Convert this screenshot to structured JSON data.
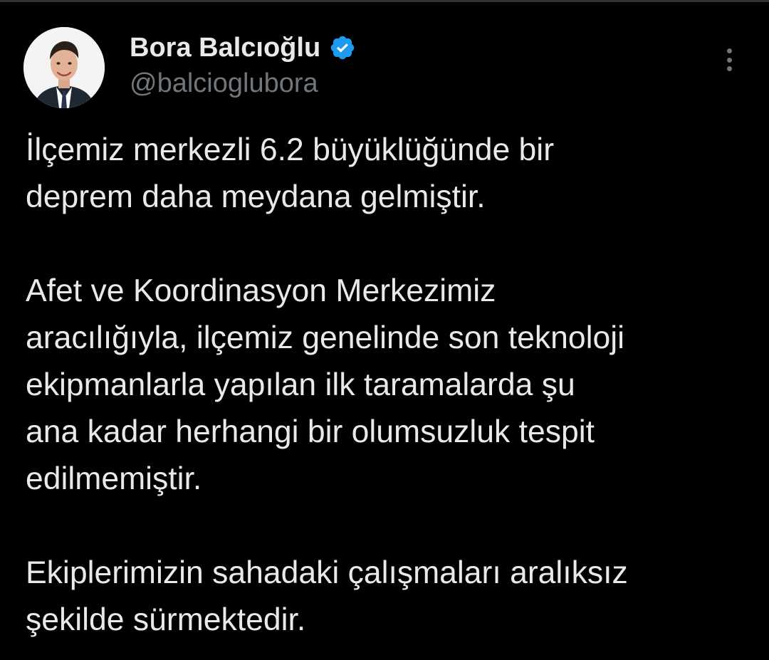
{
  "author": {
    "display_name": "Bora Balcıoğlu",
    "handle": "@balcioglubora",
    "verified": true,
    "verified_icon": "verified-badge-icon",
    "avatar_icon": "profile-photo"
  },
  "menu": {
    "icon": "more-vertical-icon"
  },
  "tweet": {
    "paragraphs": [
      "İlçemiz merkezli 6.2 büyüklüğünde bir\ndeprem daha meydana gelmiştir.",
      "Afet ve Koordinasyon Merkezimiz\naracılığıyla, ilçemiz genelinde son teknoloji\nekipmanlarla yapılan ilk taramalarda şu\nana kadar herhangi bir olumsuzluk tespit\nedilmemiştir.",
      "Ekiplerimizin sahadaki çalışmaları aralıksız\nşekilde sürmektedir."
    ]
  },
  "colors": {
    "background": "#000000",
    "text_primary": "#e7e9ea",
    "text_secondary": "#71767b",
    "verified_blue": "#1d9bf0"
  }
}
